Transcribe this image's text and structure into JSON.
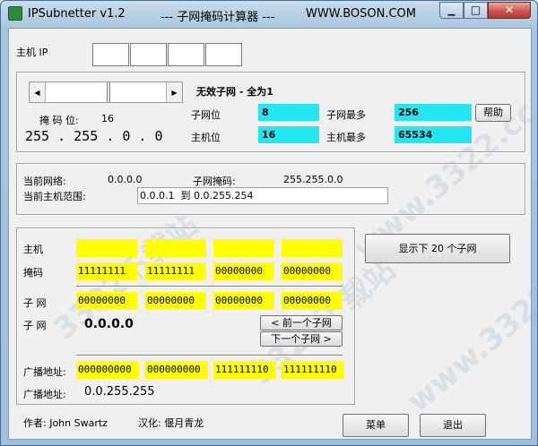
{
  "title_bar": {
    "app_title": "IPSubnetter v1.2",
    "subtitle": "--- 子网掩码计算器 ---",
    "url": "WWW.BOSON.COM",
    "minimize": "▁",
    "maximize": "□",
    "close": "✕"
  },
  "host_ip": {
    "label": "主机 IP",
    "octets": [
      "",
      "",
      "",
      ""
    ]
  },
  "slider": {
    "left_arrow": "◀",
    "right_arrow": "▶"
  },
  "mask": {
    "bits_label": "掩 码 位:",
    "bits_value": "16",
    "mask_value": "255 . 255 . 0 . 0"
  },
  "subnet_info": {
    "invalid_title": "无效子网 - 全为1",
    "subnet_bits_label": "子网位",
    "subnet_bits_value": "8",
    "max_subnets_label": "子网最多",
    "max_subnets_value": "256",
    "host_bits_label": "主机位",
    "host_bits_value": "16",
    "max_hosts_label": "主机最多",
    "max_hosts_value": "65534",
    "help_button": "帮助"
  },
  "current": {
    "network_label": "当前网络:",
    "network_value": "0.0.0.0",
    "subnet_mask_label": "子网掩码:",
    "subnet_mask_value": "255.255.0.0",
    "range_label": "当前主机范围:",
    "range_value": "0.0.0.1  到 0.0.255.254"
  },
  "binary": {
    "host_label": "主机",
    "host_octets": [
      "",
      "",
      "",
      ""
    ],
    "mask_label": "掩码",
    "mask_octets": [
      "11111111",
      "11111111",
      "00000000",
      "00000000"
    ],
    "subnet_label": "子 网",
    "subnet_octets": [
      "00000000",
      "00000000",
      "00000000",
      "00000000"
    ],
    "subnet_label2": "子 网",
    "subnet_value": "0.0.0.0",
    "prev_button": "< 前一个子网",
    "next_button": "下一个子网 >",
    "broadcast_label": "广播地址:",
    "broadcast_octets": [
      "000000000",
      "000000000",
      "111111110",
      "111111110"
    ],
    "broadcast_label2": "广播地址:",
    "broadcast_value": "0.0.255.255"
  },
  "show_subnets_button": "显示下 20 个子网",
  "footer": {
    "author": "作者: John Swartz",
    "localizer": "汉化: 偃月青龙",
    "menu_button": "菜单",
    "exit_button": "退出"
  },
  "watermarks": [
    "3322下载站",
    "www.3322.cc",
    "3322下载站",
    "www.3322.cc"
  ],
  "colors": {
    "cyan_field": "#22e6f0",
    "yellow_field": "#ffff00",
    "close_button": "#c75050"
  }
}
